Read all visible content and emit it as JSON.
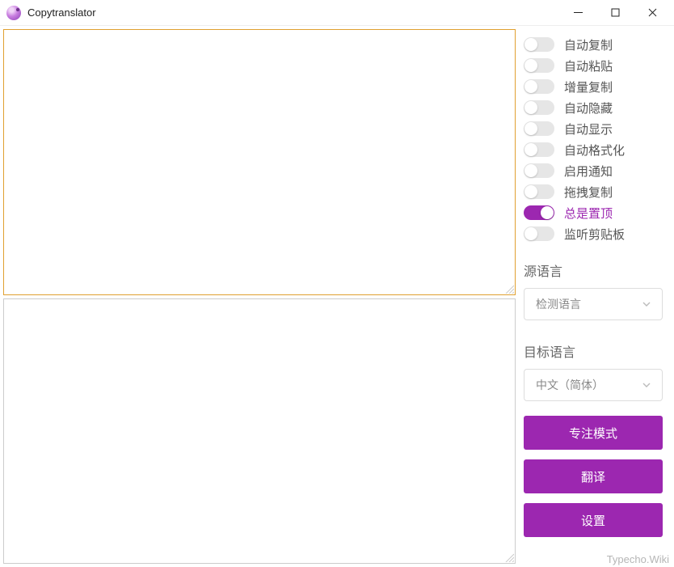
{
  "window": {
    "title": "Copytranslator"
  },
  "toggles": [
    {
      "label": "自动复制",
      "on": false
    },
    {
      "label": "自动粘贴",
      "on": false
    },
    {
      "label": "增量复制",
      "on": false
    },
    {
      "label": "自动隐藏",
      "on": false
    },
    {
      "label": "自动显示",
      "on": false
    },
    {
      "label": "自动格式化",
      "on": false
    },
    {
      "label": "启用通知",
      "on": false
    },
    {
      "label": "拖拽复制",
      "on": false
    },
    {
      "label": "总是置顶",
      "on": true
    },
    {
      "label": "监听剪贴板",
      "on": false
    }
  ],
  "source_lang": {
    "section_label": "源语言",
    "selected": "检测语言"
  },
  "target_lang": {
    "section_label": "目标语言",
    "selected": "中文（简体）"
  },
  "buttons": {
    "focus_mode": "专注模式",
    "translate": "翻译",
    "settings": "设置"
  },
  "textareas": {
    "source_value": "",
    "target_value": ""
  },
  "watermark": "Typecho.Wiki"
}
